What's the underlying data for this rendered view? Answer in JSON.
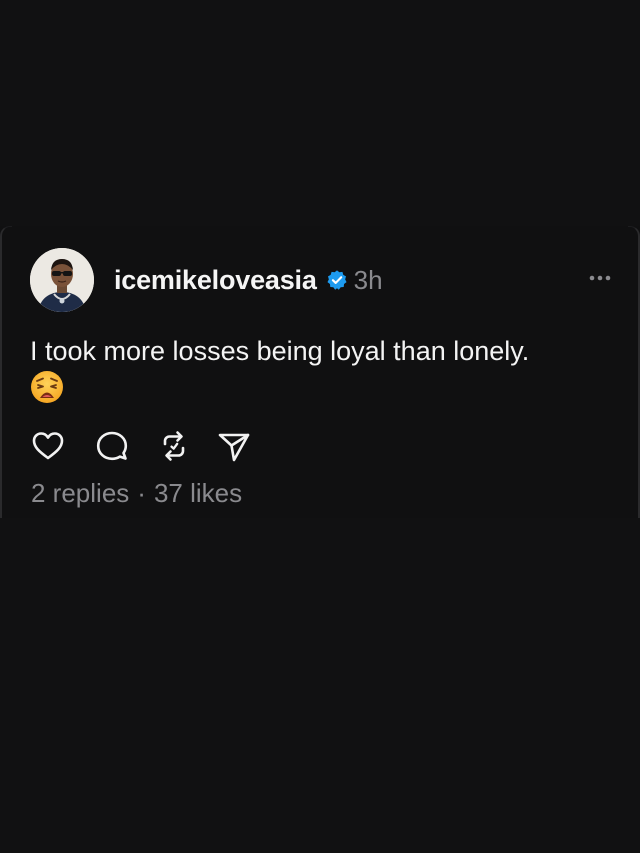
{
  "post": {
    "username": "icemikeloveasia",
    "timestamp": "3h",
    "text": "I took more losses being loyal than lonely.",
    "emoji": "weary-face-emoji",
    "verified": true
  },
  "actions": {
    "like": "heart-icon",
    "reply": "comment-icon",
    "repost": "repost-icon",
    "share": "send-icon"
  },
  "stats": {
    "replies": "2 replies",
    "separator": "·",
    "likes": "37 likes"
  },
  "colors": {
    "background": "#111112",
    "verified_badge": "#1d9bf0",
    "muted_text": "#8a8a8e",
    "primary_text": "#f4f4f4"
  }
}
